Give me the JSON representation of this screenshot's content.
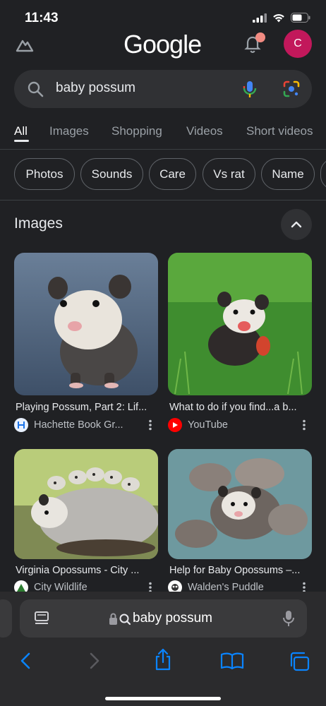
{
  "status": {
    "time": "11:43"
  },
  "header": {
    "logo": "Google",
    "avatar_letter": "C"
  },
  "search": {
    "query": "baby possum"
  },
  "tabs": [
    "All",
    "Images",
    "Shopping",
    "Videos",
    "Short videos"
  ],
  "chips": [
    "Photos",
    "Sounds",
    "Care",
    "Vs rat",
    "Name"
  ],
  "images_section": {
    "title": "Images"
  },
  "results": [
    {
      "title": "Playing Possum, Part 2: Lif...",
      "source": "Hachette Book Gr..."
    },
    {
      "title": "What to do if you find...a b...",
      "source": "YouTube"
    },
    {
      "title": "Virginia Opossums - City ...",
      "source": "City Wildlife"
    },
    {
      "title": "Help for Baby Opossums –...",
      "source": "Walden's Puddle"
    }
  ],
  "browser": {
    "url_text": "baby possum"
  },
  "colors": {
    "background": "#202124",
    "search_box": "#303134",
    "avatar": "#c2185b",
    "accent_blue": "#0a84ff"
  },
  "icons": [
    "labs-icon",
    "bell-icon",
    "search-icon",
    "mic-icon",
    "lens-icon",
    "chevron-up-icon",
    "more-vert-icon",
    "reader-icon",
    "lock-icon",
    "back-icon",
    "forward-icon",
    "share-icon",
    "bookmarks-icon",
    "tabs-icon"
  ]
}
